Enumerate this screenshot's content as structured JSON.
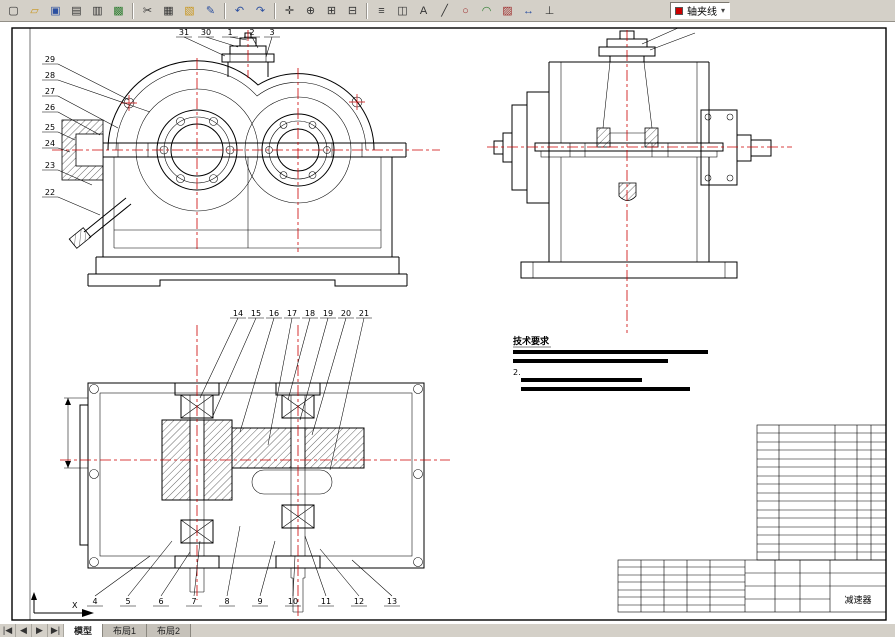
{
  "app": {
    "toolbar_bg": "#d4d0c8",
    "sheet_bg": "#ffffff",
    "line_color": "#000000",
    "centerline_color": "#cc0000"
  },
  "toolbar": {
    "icons": [
      {
        "name": "new-file",
        "glyph": "▢"
      },
      {
        "name": "open-folder",
        "glyph": "▱"
      },
      {
        "name": "save",
        "glyph": "▣"
      },
      {
        "name": "print",
        "glyph": "▤"
      },
      {
        "name": "print-preview",
        "glyph": "▥"
      },
      {
        "name": "plot",
        "glyph": "▩"
      },
      {
        "name": "cut",
        "glyph": "✂"
      },
      {
        "name": "copy",
        "glyph": "▦"
      },
      {
        "name": "paste",
        "glyph": "▧"
      },
      {
        "name": "format-painter",
        "glyph": "✎"
      },
      {
        "name": "undo",
        "glyph": "↶"
      },
      {
        "name": "redo",
        "glyph": "↷"
      },
      {
        "name": "pan",
        "glyph": "✛"
      },
      {
        "name": "zoom-realtime",
        "glyph": "⊕"
      },
      {
        "name": "zoom-window",
        "glyph": "⊞"
      },
      {
        "name": "zoom-previous",
        "glyph": "⊟"
      },
      {
        "name": "layers",
        "glyph": "≡"
      },
      {
        "name": "properties",
        "glyph": "◫"
      },
      {
        "name": "text-style",
        "glyph": "A"
      },
      {
        "name": "line-tool",
        "glyph": "╱"
      },
      {
        "name": "circle-tool",
        "glyph": "○"
      },
      {
        "name": "arc-tool",
        "glyph": "◠"
      },
      {
        "name": "hatch-tool",
        "glyph": "▨"
      },
      {
        "name": "dimension-tool",
        "glyph": "↔"
      },
      {
        "name": "ortho",
        "glyph": "⊥"
      }
    ],
    "layer_combo": {
      "value": "轴夹线",
      "dropdown_arrow": "▾"
    }
  },
  "statusbar": {
    "nav": [
      "|◀",
      "◀",
      "▶",
      "▶|"
    ],
    "tabs": [
      "模型",
      "布局1",
      "布局2"
    ],
    "active_tab": "模型"
  },
  "drawing": {
    "front_view": {
      "balloons_top": [
        "31",
        "30",
        "1",
        "2",
        "3"
      ],
      "balloons_left": [
        "29",
        "28",
        "27",
        "26",
        "25",
        "24",
        "23",
        "22"
      ]
    },
    "plan_view": {
      "balloons_top": [
        "14",
        "15",
        "16",
        "17",
        "18",
        "19",
        "20",
        "21"
      ],
      "balloons_bottom": [
        "4",
        "5",
        "6",
        "7",
        "8",
        "9",
        "10",
        "11",
        "12",
        "13"
      ]
    },
    "tech_requirements": {
      "title": "技术要求",
      "item_label": "2."
    },
    "title_block": {
      "product_name": "减速器"
    },
    "ucs": {
      "x_label": "X"
    }
  }
}
